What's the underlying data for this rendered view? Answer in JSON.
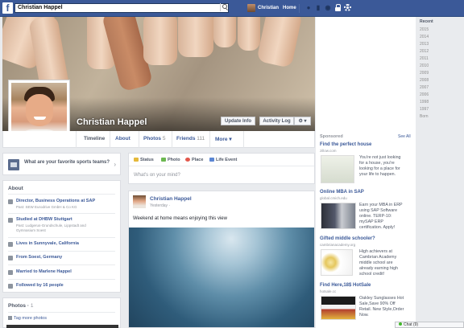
{
  "header": {
    "logo": "f",
    "search_value": "Christian Happel",
    "user_name": "Christian",
    "home_label": "Home",
    "friend_requests_icon": "friends-icon",
    "messages_icon": "messages-icon",
    "notifications_icon": "globe-icon"
  },
  "profile": {
    "name": "Christian Happel",
    "update_info": "Update Info",
    "activity_log": "Activity Log",
    "settings_glyph": "⚙ ▾"
  },
  "tabs": [
    {
      "label": "Timeline",
      "count": ""
    },
    {
      "label": "About",
      "count": ""
    },
    {
      "label": "Photos",
      "count": "5"
    },
    {
      "label": "Friends",
      "count": "111"
    },
    {
      "label": "More ▾",
      "count": ""
    }
  ],
  "sports_prompt": "What are your favorite sports teams?",
  "about": {
    "title": "About",
    "items": [
      {
        "text": "Director, Business Operations at SAP",
        "sub": "Past: SEW Eurodrive GmbH & Co KG",
        "sub2": ""
      },
      {
        "text": "Studied at DHBW Stuttgart",
        "sub": "Past: Ludgerus-Grundschule, Lippstadt and",
        "sub2": "Gymnasium Soest"
      },
      {
        "text": "Lives in Sunnyvale, California",
        "sub": "",
        "sub2": ""
      },
      {
        "text": "From Soest, Germany",
        "sub": "",
        "sub2": ""
      },
      {
        "text": "Married to Marlene Happel",
        "sub": "",
        "sub2": ""
      },
      {
        "text": "Followed by 16 people",
        "sub": "",
        "sub2": ""
      }
    ]
  },
  "photos_box": {
    "title": "Photos",
    "count": "1",
    "tag_more": "Tag more photos"
  },
  "composer": {
    "status": "Status",
    "photo": "Photo",
    "place": "Place",
    "life_event": "Life Event",
    "placeholder": "What's on your mind?"
  },
  "post": {
    "author": "Christian Happel",
    "time": "Yesterday",
    "text": "Weekend at home means enjoying this view"
  },
  "years": [
    "Recent",
    "2015",
    "2014",
    "2013",
    "2012",
    "2011",
    "2010",
    "2009",
    "2008",
    "2007",
    "2006",
    "1998",
    "1997",
    "Born"
  ],
  "sponsored": {
    "label": "Sponsored",
    "see_all": "See All",
    "ads": [
      {
        "title": "Find the perfect house",
        "url": "zillow.com",
        "text": [
          "You're not just looking",
          "for a house, you're",
          "looking for a place for",
          "your life to happen."
        ]
      },
      {
        "title": "Online MBA in SAP",
        "url": "global.cmich.edu",
        "text": [
          "Earn your MBA in ERP",
          "using SAP Software",
          "online. TERP-10:",
          "mySAP ERP",
          "certification. Apply!"
        ]
      },
      {
        "title": "Gifted middle schooler?",
        "url": "cambrianacademy.org",
        "text": [
          "High achievers at",
          "Cambrian Academy",
          "middle school are",
          "already earning high",
          "school credit!"
        ]
      },
      {
        "title": "Find Here,18$ HotSale",
        "url": "hotsale.cc",
        "text": [
          "Oakley Sunglasses Hot",
          "Sale,Save 90% Off",
          "Retail. New Style,Order",
          "Now."
        ]
      }
    ]
  },
  "chat": "Chat (9)"
}
